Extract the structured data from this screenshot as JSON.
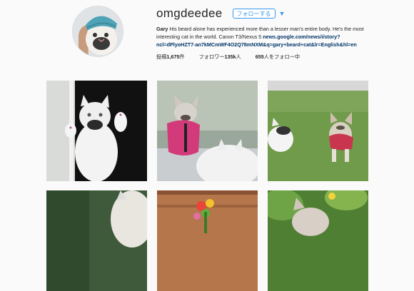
{
  "profile": {
    "username": "omgdeedee",
    "follow_label": "フォローする",
    "bio_name": "Gary",
    "bio_text": "His beard alone has experienced more than a lesser man's entire body. He's the most interesting cat in the world. Canon T3/Nexus 5",
    "bio_link": "news.google.com/news/i/story?ncl=dPlyoHZT7-an7kMCmWF4O2Q78mNXM&q=gary+beard+cat&lr=English&hl=en",
    "stats": {
      "posts_label": "投稿",
      "posts_value": "1,675",
      "posts_suffix": "件",
      "followers_label": "フォロワー",
      "followers_value": "135k",
      "followers_suffix": "人",
      "following_value": "655",
      "following_suffix": "人をフォロー中"
    }
  },
  "colors": {
    "accent": "#3897f0",
    "link": "#003569",
    "background": "#fafafa"
  },
  "icons": {
    "dropdown": "chevron-down-icon"
  },
  "posts": [
    {
      "subject": "cat-at-window"
    },
    {
      "subject": "cat-in-pink-harness"
    },
    {
      "subject": "cats-on-grass"
    },
    {
      "subject": "cat-partial"
    },
    {
      "subject": "flowers-on-wood"
    },
    {
      "subject": "cat-in-plants"
    }
  ]
}
